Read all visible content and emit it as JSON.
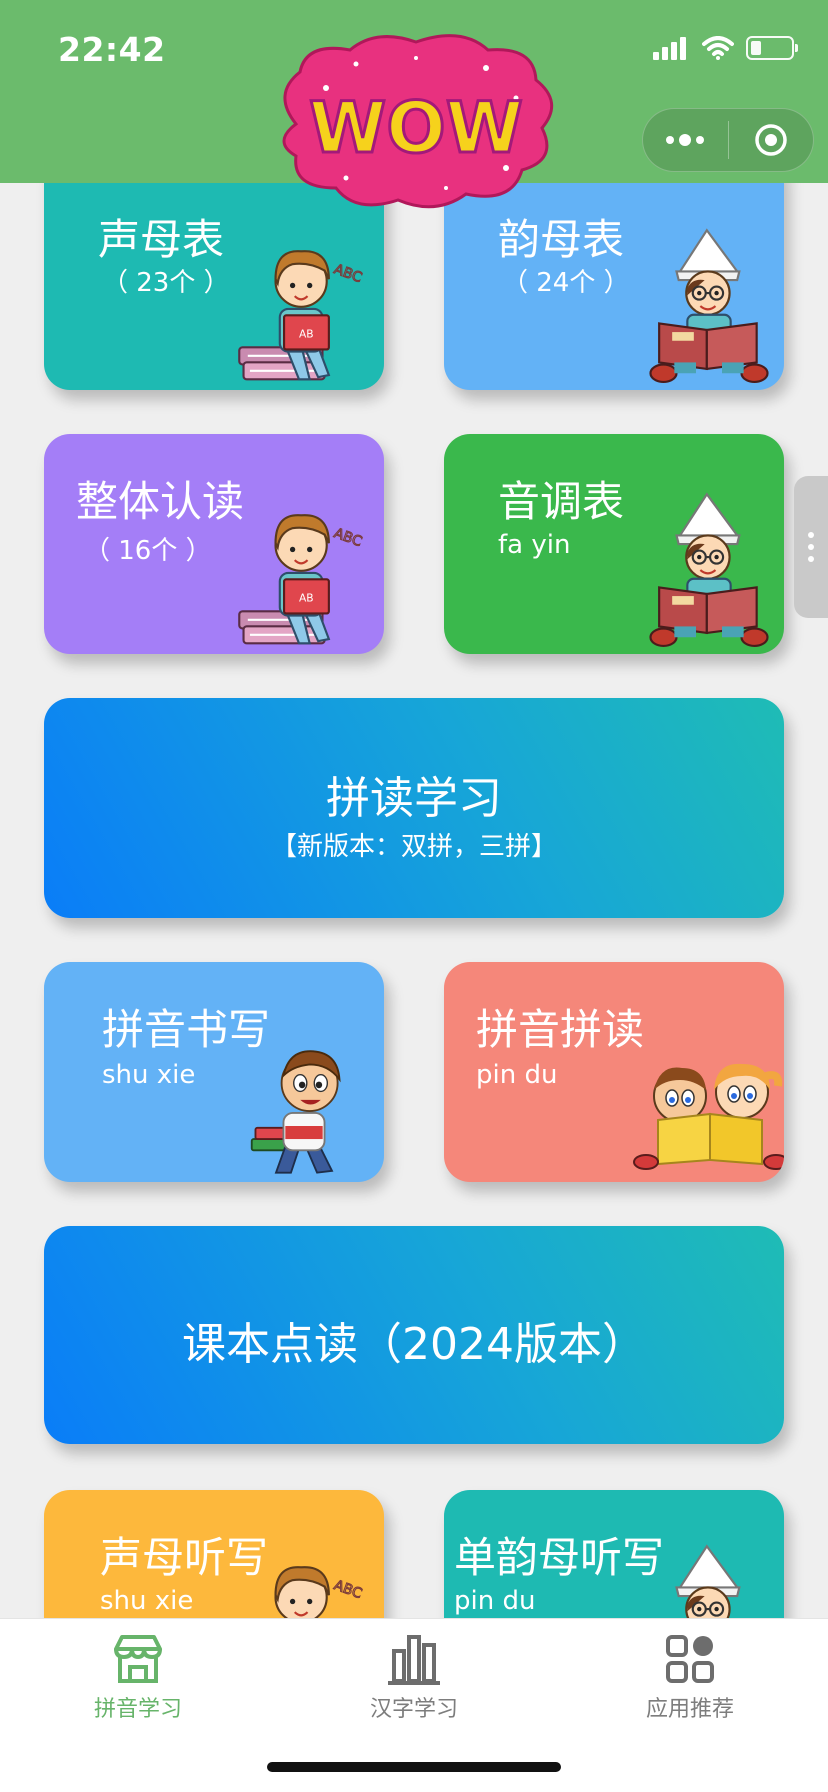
{
  "status_bar": {
    "time": "22:42",
    "battery_level": 0.25
  },
  "header": {
    "logo_text": "WOW"
  },
  "cards": {
    "shengmu": {
      "title": "声母表",
      "sub": "（ 23个 ）"
    },
    "yunmu": {
      "title": "韵母表",
      "sub": "（ 24个 ）"
    },
    "zhengti": {
      "title": "整体认读",
      "sub": "（ 16个 ）"
    },
    "yindiao": {
      "title": "音调表",
      "sub": "fa yin"
    },
    "pindu_study": {
      "title": "拼读学习",
      "sub": "【新版本：双拼，三拼】"
    },
    "shuxie": {
      "title": "拼音书写",
      "sub": "shu xie"
    },
    "pinyin_pindu": {
      "title": "拼音拼读",
      "sub": "pin du"
    },
    "textbook": {
      "title": "课本点读（2024版本）"
    },
    "shengmu_dictation": {
      "title": "声母听写",
      "sub": "shu xie"
    },
    "danyunmu_dictation": {
      "title": "单韵母听写",
      "sub": "pin du"
    }
  },
  "tabbar": {
    "tabs": [
      {
        "label": "拼音学习",
        "icon": "shop-icon",
        "active": true
      },
      {
        "label": "汉字学习",
        "icon": "bar-chart-icon",
        "active": false
      },
      {
        "label": "应用推荐",
        "icon": "apps-grid-icon",
        "active": false
      }
    ]
  },
  "colors": {
    "header": "#6bbb6c",
    "active_tab": "#67b46a",
    "teal": "#1ebab2",
    "sky": "#63b2f6",
    "purple": "#a47ef7",
    "green": "#3ab84c",
    "salmon": "#f5877a",
    "yellow": "#fdb83c"
  }
}
